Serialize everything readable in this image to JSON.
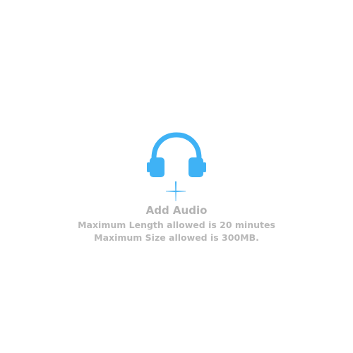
{
  "upload": {
    "title": "Add Audio",
    "max_length_text": "Maximum Length allowed is 20 minutes",
    "max_size_text": "Maximum Size allowed is 300MB."
  },
  "icons": {
    "main": "headphones-icon",
    "action": "plus-icon"
  },
  "colors": {
    "accent": "#3fb2f5",
    "text": "#b3b3b3",
    "background": "#ffffff"
  }
}
